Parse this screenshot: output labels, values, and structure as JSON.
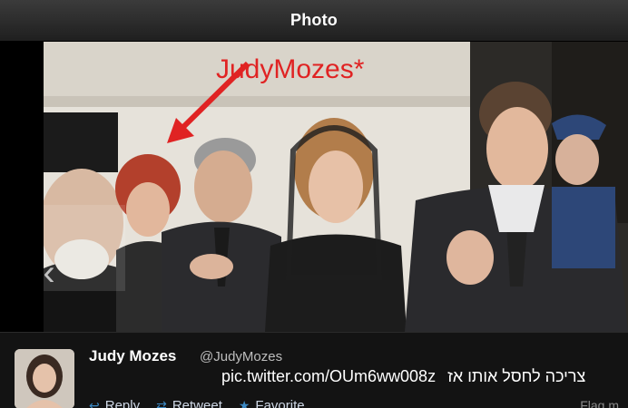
{
  "titlebar": {
    "title": "Photo"
  },
  "photo": {
    "annotation_text": "JudyMozes*",
    "annotation_color": "#e02323",
    "prev_icon": "chevron-left-icon"
  },
  "tweet": {
    "name": "Judy Mozes",
    "handle": "@JudyMozes",
    "link_text": "pic.twitter.com/OUm6ww008z",
    "hebrew_text": "צריכה לחסל אותו אז",
    "actions": [
      {
        "label": "Reply",
        "icon": "reply-icon"
      },
      {
        "label": "Retweet",
        "icon": "retweet-icon"
      },
      {
        "label": "Favorite",
        "icon": "star-icon"
      }
    ],
    "flag_label": "Flag m"
  },
  "colors": {
    "link_blue": "#3b88c3"
  }
}
